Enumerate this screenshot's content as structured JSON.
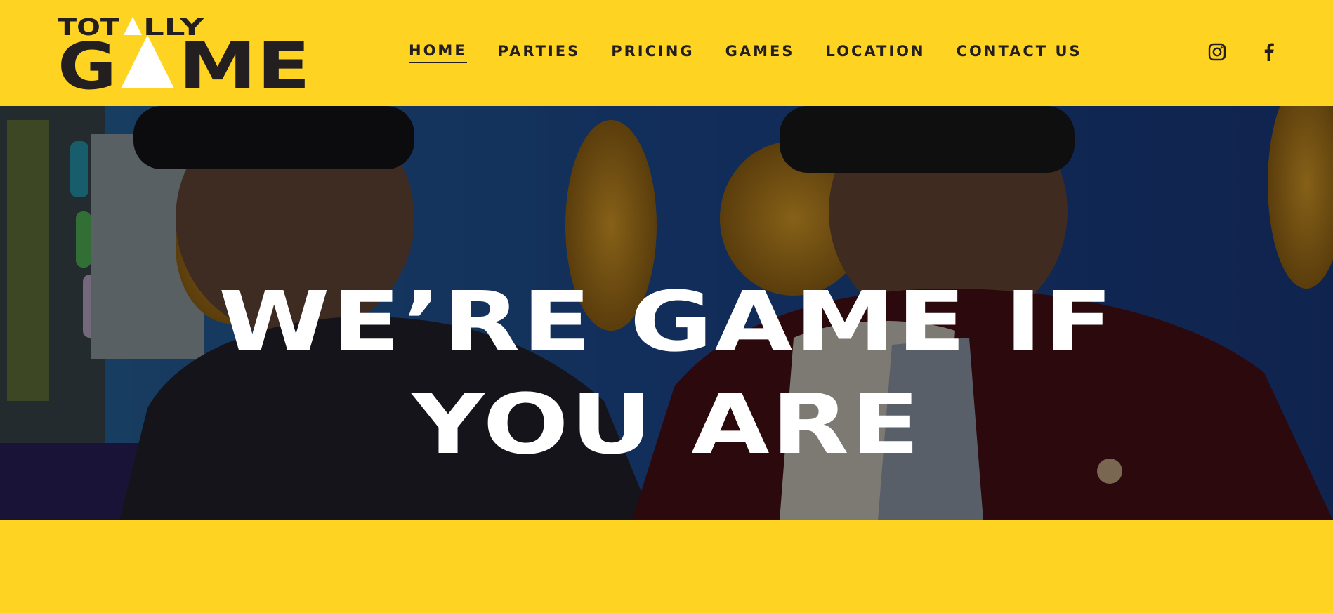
{
  "brand": {
    "logo_top": "TOTALLY",
    "logo_bottom": "GAME",
    "color_yellow": "#FFD322",
    "color_dark": "#231F20"
  },
  "nav": {
    "items": [
      {
        "label": "HOME",
        "active": true
      },
      {
        "label": "PARTIES",
        "active": false
      },
      {
        "label": "PRICING",
        "active": false
      },
      {
        "label": "GAMES",
        "active": false
      },
      {
        "label": "LOCATION",
        "active": false
      },
      {
        "label": "CONTACT US",
        "active": false
      }
    ]
  },
  "social": {
    "instagram_icon": "instagram-icon",
    "facebook_icon": "facebook-icon"
  },
  "hero": {
    "line1": "WE’RE GAME IF",
    "line2": "YOU ARE"
  }
}
